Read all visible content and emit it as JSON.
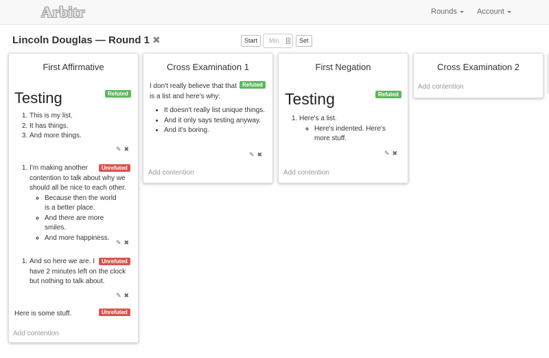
{
  "navbar": {
    "brand": "Arbitr",
    "rounds_label": "Rounds",
    "account_label": "Account"
  },
  "page": {
    "title": "Lincoln Douglas — Round 1",
    "close_glyph": "✖"
  },
  "timer": {
    "start_label": "Start",
    "minutes_placeholder": "Min.",
    "set_label": "Set"
  },
  "icons": {
    "edit": "✎",
    "delete": "✖"
  },
  "colors": {
    "refuted": "#5cb85c",
    "unrefuted": "#d9534f"
  },
  "columns": [
    {
      "title": "First Affirmative",
      "add_label": "Add contention",
      "contentions": [
        {
          "status": "Refuted",
          "heading": "Testing",
          "items": [
            "This is my list.",
            "It has things.",
            "And more things."
          ]
        },
        {
          "status": "Unrefuted",
          "text": "I'm making another contention to talk about why we should all be nice to each other.",
          "subitems": [
            "Because then the world is a better place.",
            "And there are more smiles.",
            "And more happiness."
          ]
        },
        {
          "status": "Unrefuted",
          "text": "And so here we are. I have 2 minutes left on the clock but nothing to talk about."
        },
        {
          "status": "Unrefuted",
          "text": "Here is some stuff."
        }
      ]
    },
    {
      "title": "Cross Examination 1",
      "add_label": "Add contention",
      "contentions": [
        {
          "status": "Refuted",
          "text": "I don't really believe that that is a list and here's why:",
          "items": [
            "It doesn't really list unique things.",
            "And it only says testing anyway.",
            "And it's boring."
          ]
        }
      ]
    },
    {
      "title": "First Negation",
      "add_label": "Add contention",
      "contentions": [
        {
          "status": "Refuted",
          "heading": "Testing",
          "items": [
            "Here's a list."
          ],
          "subitems": [
            "Here's indented. Here's more stuff."
          ]
        }
      ]
    },
    {
      "title": "Cross Examination 2",
      "add_label": "Add contention",
      "contentions": []
    }
  ]
}
